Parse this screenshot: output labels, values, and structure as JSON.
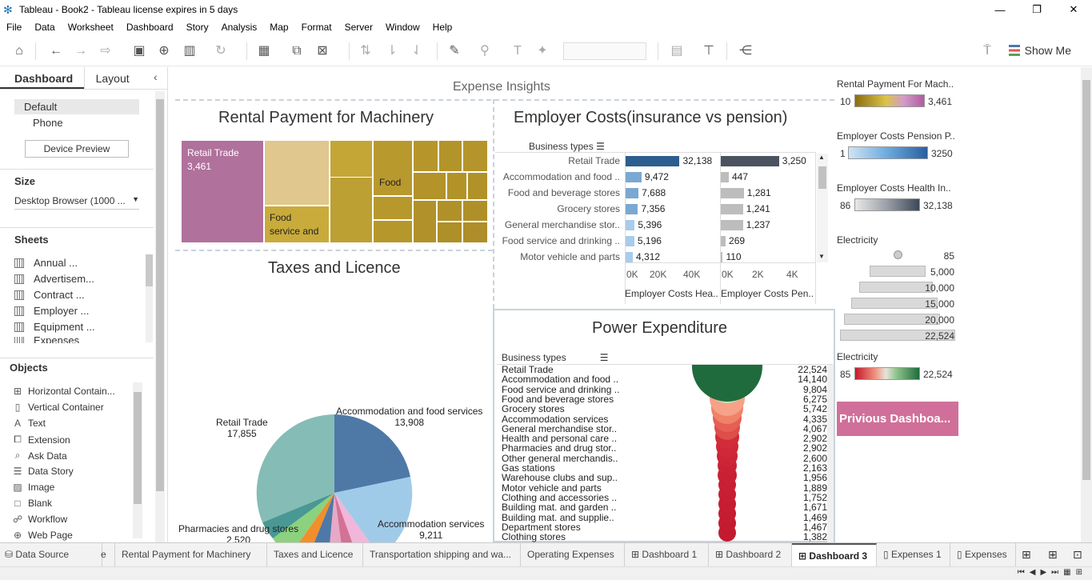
{
  "window": {
    "title": "Tableau - Book2 - Tableau license expires in 5 days"
  },
  "menu": [
    "File",
    "Data",
    "Worksheet",
    "Dashboard",
    "Story",
    "Analysis",
    "Map",
    "Format",
    "Server",
    "Window",
    "Help"
  ],
  "toolbar": {
    "show_me": "Show Me"
  },
  "left_panel": {
    "tab_dashboard": "Dashboard",
    "tab_layout": "Layout",
    "devices": [
      "Default",
      "Phone"
    ],
    "device_preview": "Device Preview",
    "size_heading": "Size",
    "size_value": "Desktop Browser (1000 ...",
    "sheets_heading": "Sheets",
    "sheets": [
      "Annual ...",
      "Advertisem...",
      "Contract ...",
      "Employer ...",
      "Equipment ...",
      "Expenses"
    ],
    "objects_heading": "Objects",
    "objects": [
      {
        "label": "Horizontal Contain...",
        "icon": "horizontal-container-icon"
      },
      {
        "label": "Vertical Container",
        "icon": "vertical-container-icon"
      },
      {
        "label": "Text",
        "icon": "text-icon"
      },
      {
        "label": "Extension",
        "icon": "extension-icon"
      },
      {
        "label": "Ask Data",
        "icon": "ask-data-icon"
      },
      {
        "label": "Data Story",
        "icon": "data-story-icon"
      },
      {
        "label": "Image",
        "icon": "image-icon"
      },
      {
        "label": "Blank",
        "icon": "blank-icon"
      },
      {
        "label": "Workflow",
        "icon": "workflow-icon"
      },
      {
        "label": "Web Page",
        "icon": "web-page-icon"
      }
    ]
  },
  "dashboard": {
    "title": "Expense Insights",
    "rental": {
      "title": "Rental Payment for  Machinery",
      "label_retail": "Retail Trade",
      "value_retail": "3,461",
      "label_food": "Food",
      "label_food_service": "Food",
      "label_food_service_2": "service and"
    },
    "employer": {
      "title": "Employer Costs(insurance vs pension)",
      "header": "Business types",
      "rows": [
        {
          "cat": "Retail Trade",
          "health": 32138,
          "health_label": "32,138",
          "pension": 3250,
          "pension_label": "3,250"
        },
        {
          "cat": "Accommodation and food ..",
          "health": 9472,
          "health_label": "9,472",
          "pension": 447,
          "pension_label": "447"
        },
        {
          "cat": "Food and beverage stores",
          "health": 7688,
          "health_label": "7,688",
          "pension": 1281,
          "pension_label": "1,281"
        },
        {
          "cat": "Grocery stores",
          "health": 7356,
          "health_label": "7,356",
          "pension": 1241,
          "pension_label": "1,241"
        },
        {
          "cat": "General merchandise stor..",
          "health": 5396,
          "health_label": "5,396",
          "pension": 1237,
          "pension_label": "1,237"
        },
        {
          "cat": "Food service and drinking ..",
          "health": 5196,
          "health_label": "5,196",
          "pension": 269,
          "pension_label": "269"
        },
        {
          "cat": "Motor vehicle and parts",
          "health": 4312,
          "health_label": "4,312",
          "pension": 110,
          "pension_label": "110"
        }
      ],
      "axis_health": [
        "0K",
        "20K",
        "40K"
      ],
      "axis_pension": [
        "0K",
        "2K",
        "4K"
      ],
      "axis_health_title": "Employer Costs Hea..",
      "axis_pension_title": "Employer Costs Pen.."
    },
    "taxes": {
      "title": "Taxes and Licence",
      "labels": [
        {
          "name": "Retail Trade",
          "value": "17,855"
        },
        {
          "name": "Accommodation and food services",
          "value": "13,908"
        },
        {
          "name": "Accommodation services",
          "value": "9,211"
        },
        {
          "name": "Pharmacies and drug stores",
          "value": "2,520"
        }
      ]
    },
    "power": {
      "title": "Power Expenditure",
      "header": "Business types",
      "rows": [
        {
          "cat": "Retail Trade",
          "val": "22,524"
        },
        {
          "cat": "Accommodation and food ..",
          "val": "14,140"
        },
        {
          "cat": "Food service and drinking ..",
          "val": "9,804"
        },
        {
          "cat": "Food and beverage stores",
          "val": "6,275"
        },
        {
          "cat": "Grocery stores",
          "val": "5,742"
        },
        {
          "cat": "Accommodation services",
          "val": "4,335"
        },
        {
          "cat": "General merchandise stor..",
          "val": "4,067"
        },
        {
          "cat": "Health and personal care ..",
          "val": "2,902"
        },
        {
          "cat": "Pharmacies and drug stor..",
          "val": "2,902"
        },
        {
          "cat": "Other general merchandis..",
          "val": "2,600"
        },
        {
          "cat": "Gas stations",
          "val": "2,163"
        },
        {
          "cat": "Warehouse clubs and sup..",
          "val": "1,956"
        },
        {
          "cat": "Motor vehicle and parts",
          "val": "1,889"
        },
        {
          "cat": "Clothing and accessories ..",
          "val": "1,752"
        },
        {
          "cat": "Building mat. and garden ..",
          "val": "1,671"
        },
        {
          "cat": "Building mat. and supplie..",
          "val": "1,469"
        },
        {
          "cat": "Department stores",
          "val": "1,467"
        },
        {
          "cat": "Clothing stores",
          "val": "1,382"
        }
      ]
    }
  },
  "legends": {
    "rental": {
      "title": "Rental Payment For Mach..",
      "min": "10",
      "max": "3,461"
    },
    "pension": {
      "title": "Employer Costs Pension P..",
      "min": "1",
      "max": "3250"
    },
    "health": {
      "title": "Employer Costs Health In..",
      "min": "86",
      "max": "32,138"
    },
    "electricity_size": {
      "title": "Electricity",
      "values": [
        "85",
        "5,000",
        "10,000",
        "15,000",
        "20,000",
        "22,524"
      ]
    },
    "electricity_color": {
      "title": "Electricity",
      "min": "85",
      "max": "22,524"
    }
  },
  "previous_button": "Privious Dashboa...",
  "bottom_tabs": [
    {
      "label": "Data Source"
    },
    {
      "label": "e"
    },
    {
      "label": "Rental Payment for  Machinery"
    },
    {
      "label": "Taxes and Licence"
    },
    {
      "label": "Transportation shipping and wa..."
    },
    {
      "label": "Operating Expenses"
    },
    {
      "label": "Dashboard 1"
    },
    {
      "label": "Dashboard 2"
    },
    {
      "label": "Dashboard 3"
    },
    {
      "label": "Expenses 1"
    },
    {
      "label": "Expenses"
    }
  ],
  "colors": {
    "retail_treemap": "#b0719c",
    "gold": "#b59a2c",
    "light_gold": "#dfc78e",
    "health_bar": "#2c5e8f",
    "pension_bar": "#4b5360",
    "pink_button": "#d0709a"
  }
}
